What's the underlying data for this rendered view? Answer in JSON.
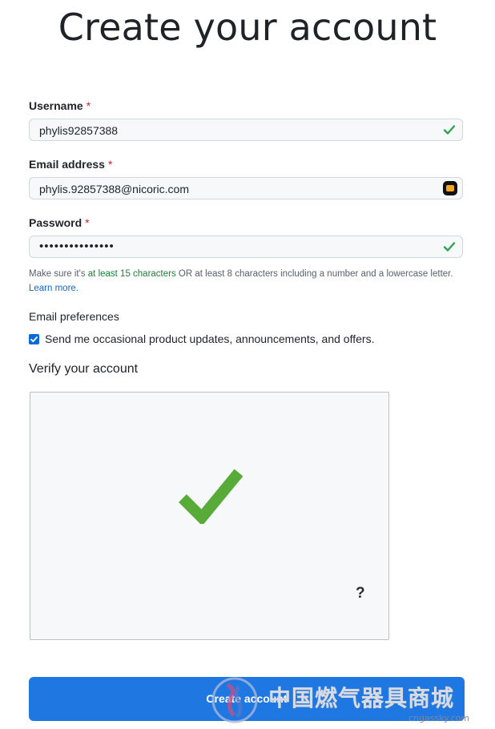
{
  "page": {
    "title": "Create your account"
  },
  "form": {
    "username": {
      "label": "Username",
      "required_mark": "*",
      "value": "phylis92857388"
    },
    "email": {
      "label": "Email address",
      "required_mark": "*",
      "value": "phylis.92857388@nicoric.com"
    },
    "password": {
      "label": "Password",
      "required_mark": "*",
      "value": "•••••••••••••••",
      "hint_prefix": "Make sure it's ",
      "hint_highlight": "at least 15 characters",
      "hint_suffix": " OR at least 8 characters including a number and a lowercase letter.",
      "hint_link": "Learn more."
    },
    "email_preferences": {
      "label": "Email preferences",
      "checkbox_label": "Send me occasional product updates, announcements, and offers.",
      "checked": true
    },
    "verify": {
      "label": "Verify your account",
      "help_glyph": "?"
    },
    "submit": {
      "label": "Create account"
    }
  },
  "watermark": {
    "text": "中国燃气器具商城",
    "url": "cngassky.com"
  },
  "colors": {
    "primary": "#1f78e2",
    "success": "#2da44e",
    "required": "#cf222e",
    "link": "#0969da",
    "hint_green": "#1a7f37"
  }
}
